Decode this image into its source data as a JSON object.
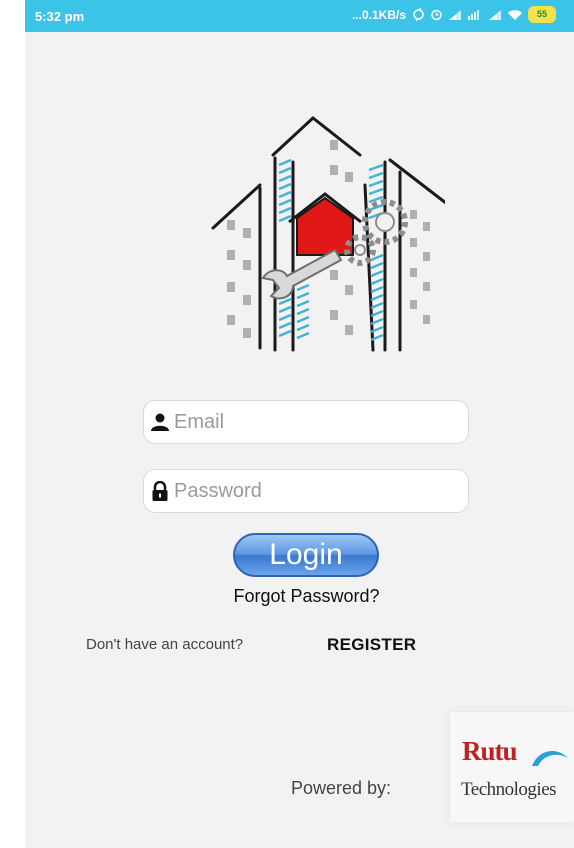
{
  "status_bar": {
    "time": "5:32 pm",
    "network_speed": "...0.1KB/s",
    "battery": "55",
    "color": "#3cc3e8"
  },
  "logo": {
    "icon": "buildings-house-wrench-gear-logo",
    "accent_colors": {
      "stripes": "#3fb4d4",
      "house": "#e01818",
      "gears": "#9a9a9a"
    }
  },
  "login_form": {
    "email_placeholder": "Email",
    "email_value": "",
    "email_icon": "person-icon",
    "password_placeholder": "Password",
    "password_value": "",
    "password_icon": "lock-icon",
    "login_label": "Login",
    "forgot_password_label": "Forgot Password?"
  },
  "register": {
    "prompt": "Don't have an account?",
    "link_label": "REGISTER"
  },
  "footer": {
    "powered_by_label": "Powered by:",
    "company_name": "Rutu",
    "company_sub": "Technologies",
    "company_color": "#c02020"
  }
}
